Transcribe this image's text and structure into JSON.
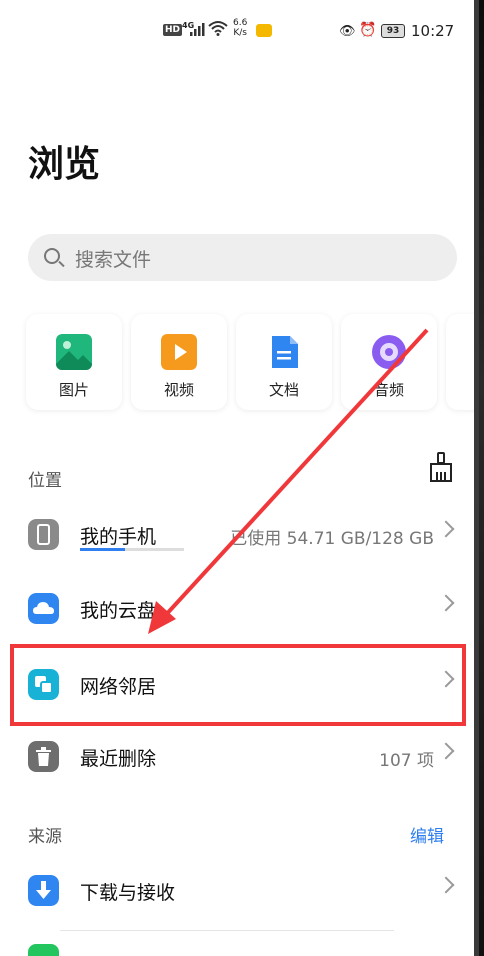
{
  "status_bar": {
    "hd": "HD",
    "network": "4G",
    "speed_top": "6.6",
    "speed_bottom": "K/s",
    "battery": "93",
    "time": "10:27"
  },
  "page_title": "浏览",
  "search": {
    "placeholder": "搜索文件"
  },
  "categories": [
    {
      "label": "图片",
      "icon": "image-icon",
      "color": "#1fb77b"
    },
    {
      "label": "视频",
      "icon": "video-icon",
      "color": "#f59a1c"
    },
    {
      "label": "文档",
      "icon": "document-icon",
      "color": "#2f86f0"
    },
    {
      "label": "音频",
      "icon": "audio-icon",
      "color": "#8a5cf0"
    }
  ],
  "locations": {
    "title": "位置",
    "items": [
      {
        "label": "我的手机",
        "value": "已使用 54.71 GB/128 GB",
        "icon": "phone-icon",
        "storage_used_fraction": 0.43
      },
      {
        "label": "我的云盘",
        "value": "",
        "icon": "cloud-icon"
      },
      {
        "label": "网络邻居",
        "value": "",
        "icon": "network-neighbor-icon"
      },
      {
        "label": "最近删除",
        "value": "107 项",
        "icon": "trash-icon"
      }
    ]
  },
  "sources": {
    "title": "来源",
    "edit_label": "编辑",
    "items": [
      {
        "label": "下载与接收",
        "icon": "download-icon"
      }
    ]
  },
  "colors": {
    "accent": "#2f7ff0",
    "highlight": "#f0383b"
  }
}
